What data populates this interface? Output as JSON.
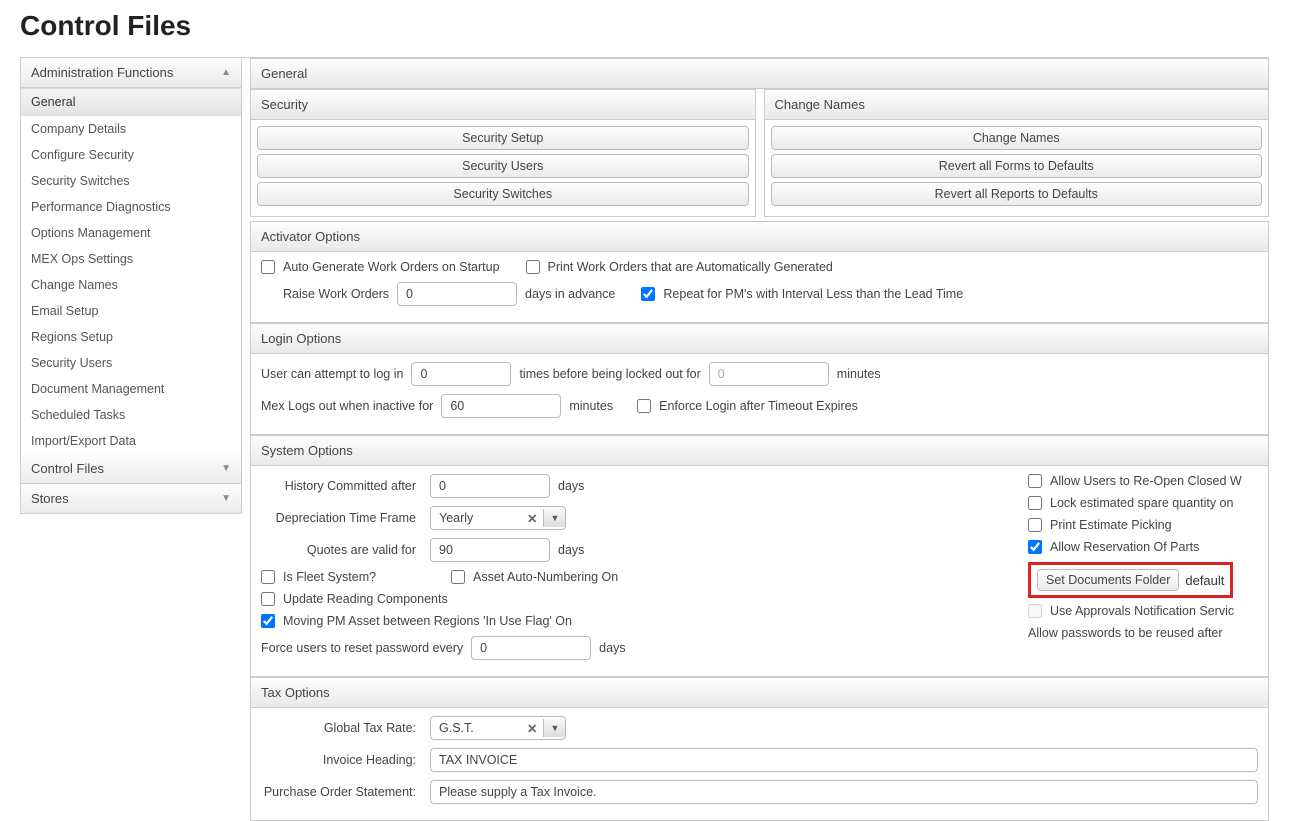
{
  "page_title": "Control Files",
  "sidebar": {
    "sections": [
      {
        "label": "Administration Functions",
        "expanded": true,
        "items": [
          "General",
          "Company Details",
          "Configure Security",
          "Security Switches",
          "Performance Diagnostics",
          "Options Management",
          "MEX Ops Settings",
          "Change Names",
          "Email Setup",
          "Regions Setup",
          "Security Users",
          "Document Management",
          "Scheduled Tasks",
          "Import/Export Data"
        ],
        "active": "General"
      },
      {
        "label": "Control Files",
        "expanded": false
      },
      {
        "label": "Stores",
        "expanded": false
      }
    ]
  },
  "main": {
    "header": "General",
    "security": {
      "title": "Security",
      "buttons": [
        "Security Setup",
        "Security Users",
        "Security Switches"
      ]
    },
    "change_names": {
      "title": "Change Names",
      "buttons": [
        "Change Names",
        "Revert all Forms to Defaults",
        "Revert all Reports to Defaults"
      ]
    },
    "activator": {
      "title": "Activator Options",
      "auto_gen_label": "Auto Generate Work Orders on Startup",
      "auto_gen_checked": false,
      "print_label": "Print Work Orders that are Automatically Generated",
      "print_checked": false,
      "raise_label": "Raise Work Orders",
      "raise_value": "0",
      "raise_suffix": "days in advance",
      "repeat_label": "Repeat for PM's with Interval Less than the Lead Time",
      "repeat_checked": true
    },
    "login": {
      "title": "Login Options",
      "attempt_label": "User can attempt to log in",
      "attempt_value": "0",
      "attempt_mid": "times before being locked out for",
      "lockout_value": "0",
      "lockout_suffix": "minutes",
      "inactive_label": "Mex Logs out when inactive for",
      "inactive_value": "60",
      "inactive_suffix": "minutes",
      "enforce_label": "Enforce Login after Timeout Expires",
      "enforce_checked": false
    },
    "system": {
      "title": "System Options",
      "history_label": "History Committed after",
      "history_value": "0",
      "history_suffix": "days",
      "depr_label": "Depreciation Time Frame",
      "depr_value": "Yearly",
      "quotes_label": "Quotes are valid for",
      "quotes_value": "90",
      "quotes_suffix": "days",
      "fleet_label": "Is Fleet System?",
      "fleet_checked": false,
      "asset_auto_label": "Asset Auto-Numbering On",
      "asset_auto_checked": false,
      "update_reading_label": "Update Reading Components",
      "update_reading_checked": false,
      "moving_pm_label": "Moving PM Asset between Regions 'In Use Flag' On",
      "moving_pm_checked": true,
      "force_reset_label": "Force users to reset password every",
      "force_reset_value": "0",
      "force_reset_suffix": "days",
      "allow_reopen_label": "Allow Users to Re-Open Closed W",
      "allow_reopen_checked": false,
      "lock_estimate_label": "Lock estimated spare quantity on",
      "lock_estimate_checked": false,
      "print_estimate_label": "Print Estimate Picking",
      "print_estimate_checked": false,
      "allow_res_label": "Allow Reservation Of Parts",
      "allow_res_checked": true,
      "set_docs_btn": "Set Documents Folder",
      "set_docs_value": "default",
      "approvals_label": "Use Approvals Notification Servic",
      "reuse_label": "Allow passwords to be reused after"
    },
    "tax": {
      "title": "Tax Options",
      "rate_label": "Global Tax Rate:",
      "rate_value": "G.S.T.",
      "invoice_label": "Invoice Heading:",
      "invoice_value": "TAX INVOICE",
      "po_label": "Purchase Order Statement:",
      "po_value": "Please supply a Tax Invoice."
    }
  }
}
